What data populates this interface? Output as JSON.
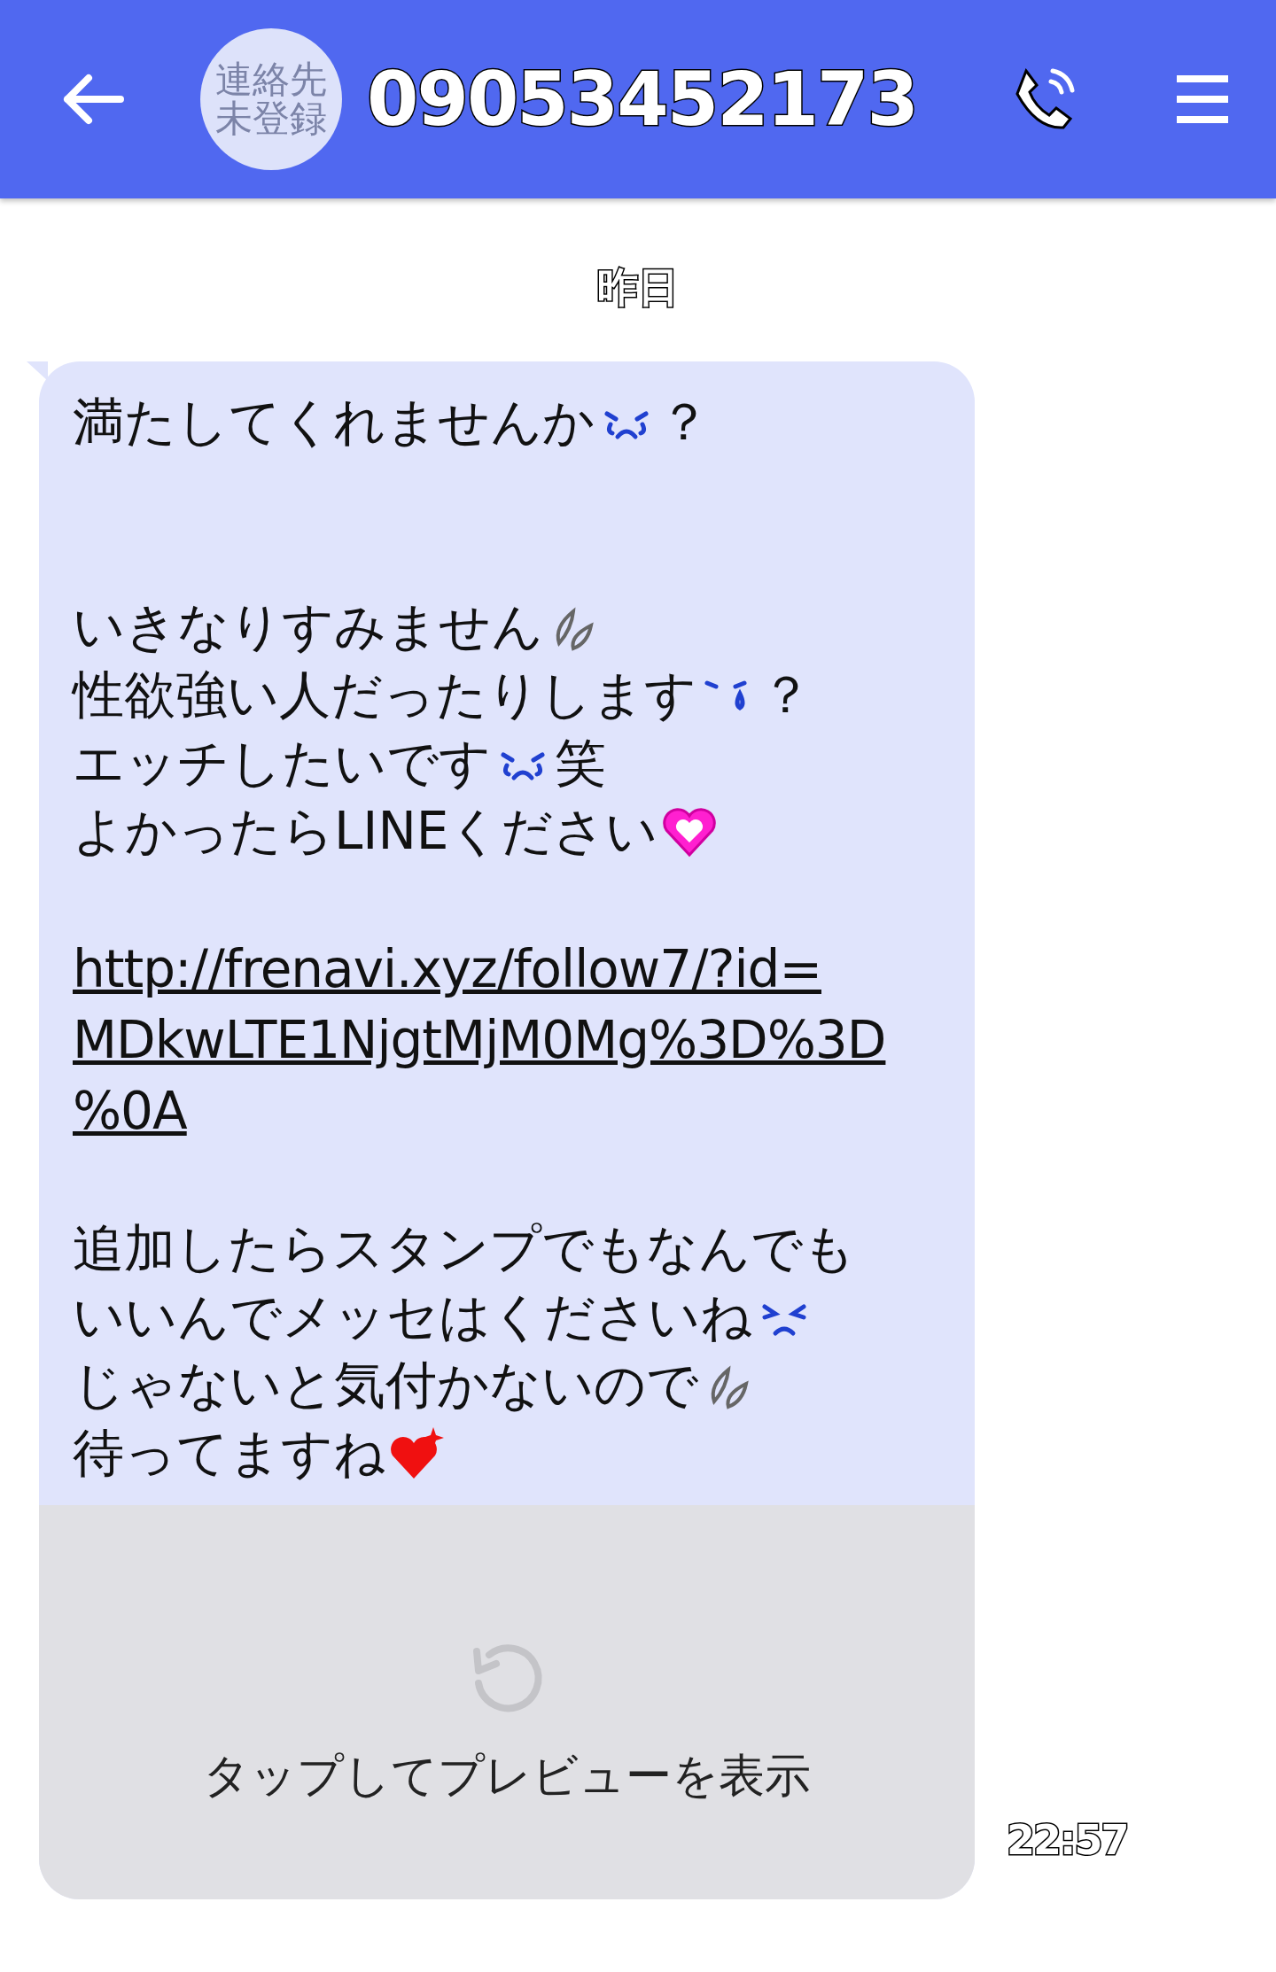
{
  "header": {
    "avatar_lines": [
      "連絡先",
      "未登録"
    ],
    "title": "09053452173"
  },
  "date_label": "昨日",
  "message": {
    "lines": [
      {
        "kind": "text",
        "segments": [
          {
            "kind": "text",
            "text": "満たしてくれませんか"
          },
          {
            "kind": "crying"
          },
          {
            "kind": "text",
            "text": "？"
          }
        ]
      },
      {
        "kind": "blank"
      },
      {
        "kind": "blank"
      },
      {
        "kind": "text",
        "segments": [
          {
            "kind": "text",
            "text": "いきなりすみません"
          },
          {
            "kind": "sweat"
          }
        ]
      },
      {
        "kind": "text",
        "segments": [
          {
            "kind": "text",
            "text": "性欲強い人だったりします"
          },
          {
            "kind": "tear"
          },
          {
            "kind": "text",
            "text": "？"
          }
        ]
      },
      {
        "kind": "text",
        "segments": [
          {
            "kind": "text",
            "text": "エッチしたいです"
          },
          {
            "kind": "crying"
          },
          {
            "kind": "text",
            "text": "笑"
          }
        ]
      },
      {
        "kind": "text",
        "segments": [
          {
            "kind": "text",
            "text": "よかったらLINEください"
          },
          {
            "kind": "heart"
          }
        ]
      },
      {
        "kind": "blank"
      },
      {
        "kind": "link",
        "parts": [
          "http://frenavi.xyz/follow7/?id=",
          "MDkwLTE1NjgtMjM0Mg%3D%3D",
          "%0A"
        ]
      },
      {
        "kind": "blank"
      },
      {
        "kind": "text",
        "segments": [
          {
            "kind": "text",
            "text": "追加したらスタンプでもなんでも"
          }
        ]
      },
      {
        "kind": "text",
        "segments": [
          {
            "kind": "text",
            "text": "いいんでメッセはくださいね"
          },
          {
            "kind": "frown"
          }
        ]
      },
      {
        "kind": "text",
        "segments": [
          {
            "kind": "text",
            "text": "じゃないと気付かないので"
          },
          {
            "kind": "sweat"
          }
        ]
      },
      {
        "kind": "text",
        "segments": [
          {
            "kind": "text",
            "text": "待ってますね"
          },
          {
            "kind": "sparkle"
          }
        ]
      }
    ],
    "preview": {
      "label": "タップしてプレビューを表示"
    },
    "time": "22:57"
  }
}
